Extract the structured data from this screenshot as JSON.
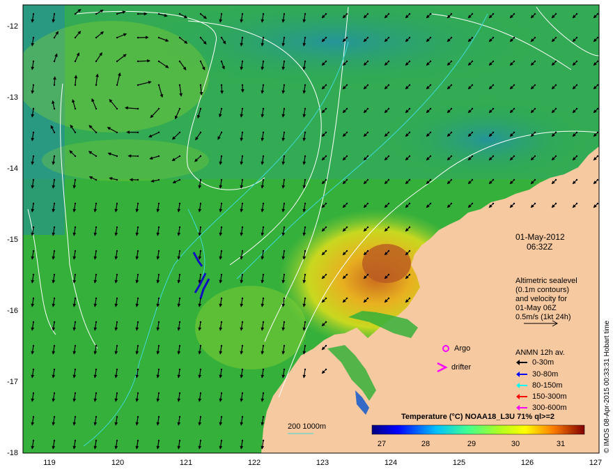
{
  "map": {
    "date": "01-May-2012",
    "time": "06:32Z",
    "altimetry_note": [
      "Altimetric sealevel",
      "(0.1m contours)",
      "and velocity for",
      "01-May 06Z",
      "0.5m/s (1kt 24h)"
    ],
    "argo_label": "Argo",
    "drifter_label": "drifter",
    "anmn_title": "ANMN 12h av.",
    "anmn_legend": [
      {
        "label": "0-30m",
        "color": "#000000"
      },
      {
        "label": "30-80m",
        "color": "#0000ff"
      },
      {
        "label": "80-150m",
        "color": "#00ffff"
      },
      {
        "label": "150-300m",
        "color": "#ff0000"
      },
      {
        "label": "300-600m",
        "color": "#ff00ff"
      }
    ],
    "depth_contour_label": "200 1000m",
    "colorbar_title": "Temperature (°C) NOAA18_L3U 71% ql>=2",
    "colorbar_ticks": [
      "27",
      "28",
      "29",
      "30",
      "31"
    ],
    "credit": "© IMOS 08-Apr-2015 00:33:31 Hobart time",
    "lat_ticks": [
      "-12",
      "-13",
      "-14",
      "-15",
      "-16",
      "-17",
      "-18"
    ],
    "lon_ticks": [
      "119",
      "120",
      "121",
      "122",
      "123",
      "124",
      "125",
      "126",
      "127"
    ],
    "colors": {
      "land": "#f7c9a0",
      "sea_base": "#2fae3c",
      "cool": "#22a3c9",
      "warm": "#e0c020",
      "hot": "#d9781f",
      "contour_sealevel": "#ffffff",
      "contour_depth": "#3fd9d9",
      "argo": "#ff00ff"
    }
  }
}
